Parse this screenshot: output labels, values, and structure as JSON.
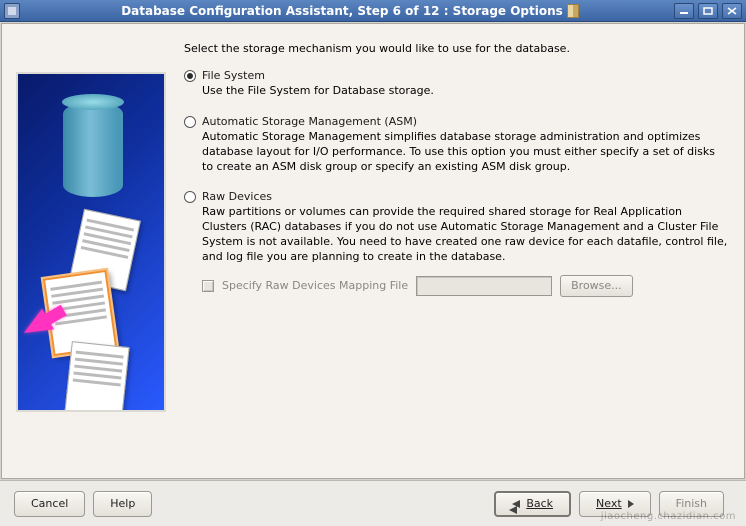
{
  "window": {
    "title": "Database Configuration Assistant, Step 6 of 12 : Storage Options"
  },
  "instruction": "Select the storage mechanism you would like to use for the database.",
  "options": {
    "filesystem": {
      "selected": true,
      "title": "File System",
      "desc": "Use the File System for Database storage."
    },
    "asm": {
      "selected": false,
      "title": "Automatic Storage Management (ASM)",
      "desc": "Automatic Storage Management simplifies database storage administration and optimizes database layout for I/O performance. To use this option you must either specify a set of disks to create an ASM disk group or specify an existing ASM disk group."
    },
    "raw": {
      "selected": false,
      "title": "Raw Devices",
      "desc": "Raw partitions or volumes can provide the required shared storage for Real Application Clusters (RAC) databases if you do not use Automatic Storage Management and a Cluster File System is not available.  You need to have created one raw device for each datafile, control file, and log file you are planning to create in the database.",
      "mapping_checkbox_label": "Specify Raw Devices Mapping File",
      "mapping_value": "",
      "browse_label": "Browse..."
    }
  },
  "footer": {
    "cancel": "Cancel",
    "help": "Help",
    "back": "Back",
    "next": "Next",
    "finish": "Finish"
  },
  "watermark": "jiaocheng.chazidian.com"
}
